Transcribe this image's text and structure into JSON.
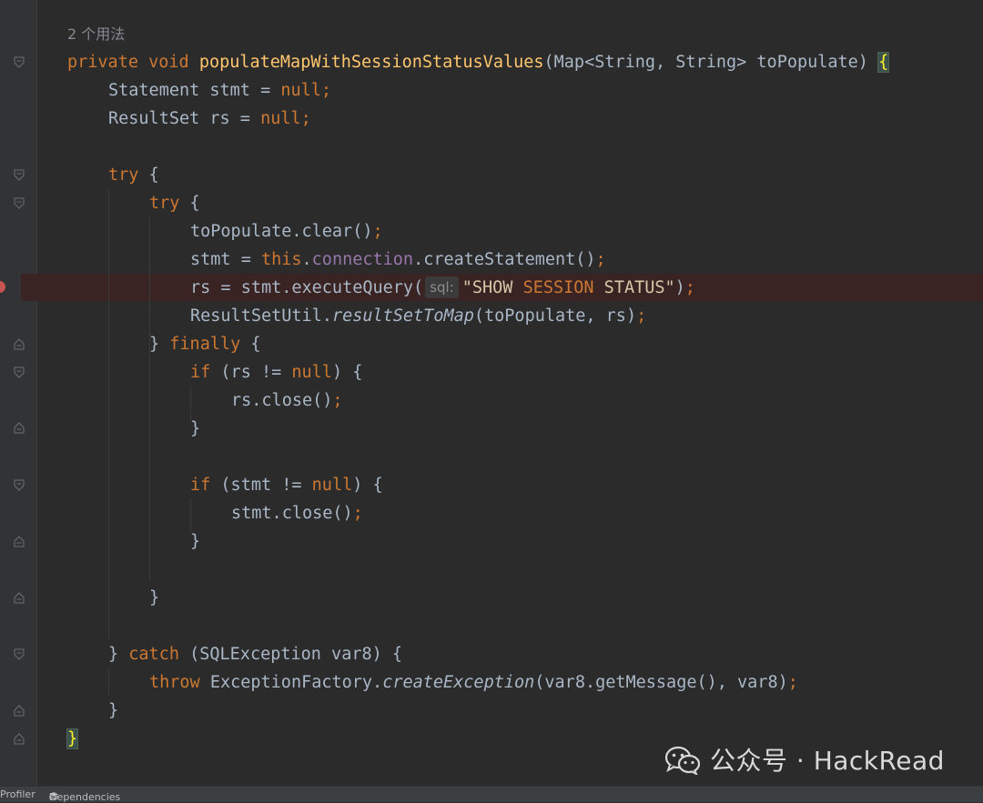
{
  "editor": {
    "usage_hint": "2 个用法",
    "param_hint_label": "sql:",
    "lines": {
      "l1_kw1": "private",
      "l1_kw2": "void",
      "l1_name": "populateMapWithSessionStatusValues",
      "l1_sig": "(Map<String, String> toPopulate) ",
      "l1_brace": "{",
      "l2": "Statement stmt = ",
      "l2_null": "null",
      "l2_semi": ";",
      "l3": "ResultSet rs = ",
      "l3_null": "null",
      "l3_semi": ";",
      "l5_try": "try",
      "l5_rest": " {",
      "l6_try": "try",
      "l6_rest": " {",
      "l7": "toPopulate.clear()",
      "l7_semi": ";",
      "l8_a": "stmt = ",
      "l8_this": "this",
      "l8_dot": ".",
      "l8_field": "connection",
      "l8_b": ".createStatement()",
      "l8_semi": ";",
      "l9_a": "rs = stmt.executeQuery(",
      "l9_s1": "\"SHOW ",
      "l9_s2": "SESSION",
      "l9_s3": " STATUS\"",
      "l9_b": ")",
      "l9_semi": ";",
      "l10_a": "ResultSetUtil.",
      "l10_it": "resultSetToMap",
      "l10_b": "(toPopulate, rs)",
      "l10_semi": ";",
      "l11_a": "} ",
      "l11_kw": "finally",
      "l11_b": " {",
      "l12_kw": "if",
      "l12_a": " (rs != ",
      "l12_null": "null",
      "l12_b": ") {",
      "l13": "rs.close()",
      "l13_semi": ";",
      "l14": "}",
      "l16_kw": "if",
      "l16_a": " (stmt != ",
      "l16_null": "null",
      "l16_b": ") {",
      "l17": "stmt.close()",
      "l17_semi": ";",
      "l18": "}",
      "l20": "}",
      "l22_a": "} ",
      "l22_kw": "catch",
      "l22_b": " (SQLException var8) {",
      "l23_kw": "throw",
      "l23_a": " ExceptionFactory.",
      "l23_it": "createException",
      "l23_b": "(var8.getMessage(), var8)",
      "l23_semi": ";",
      "l24": "}",
      "l25": "}"
    }
  },
  "status_bar": {
    "profiler": "Profiler",
    "dependencies": "Dependencies"
  },
  "watermark": {
    "text": "公众号 · HackRead",
    "icon": "wechat-icon"
  },
  "colors": {
    "background": "#2b2b2b",
    "keyword": "#cc7832",
    "method_decl": "#ffc66d",
    "field": "#9876aa",
    "default_text": "#a9b7c6",
    "breakpoint": "#c75450"
  }
}
